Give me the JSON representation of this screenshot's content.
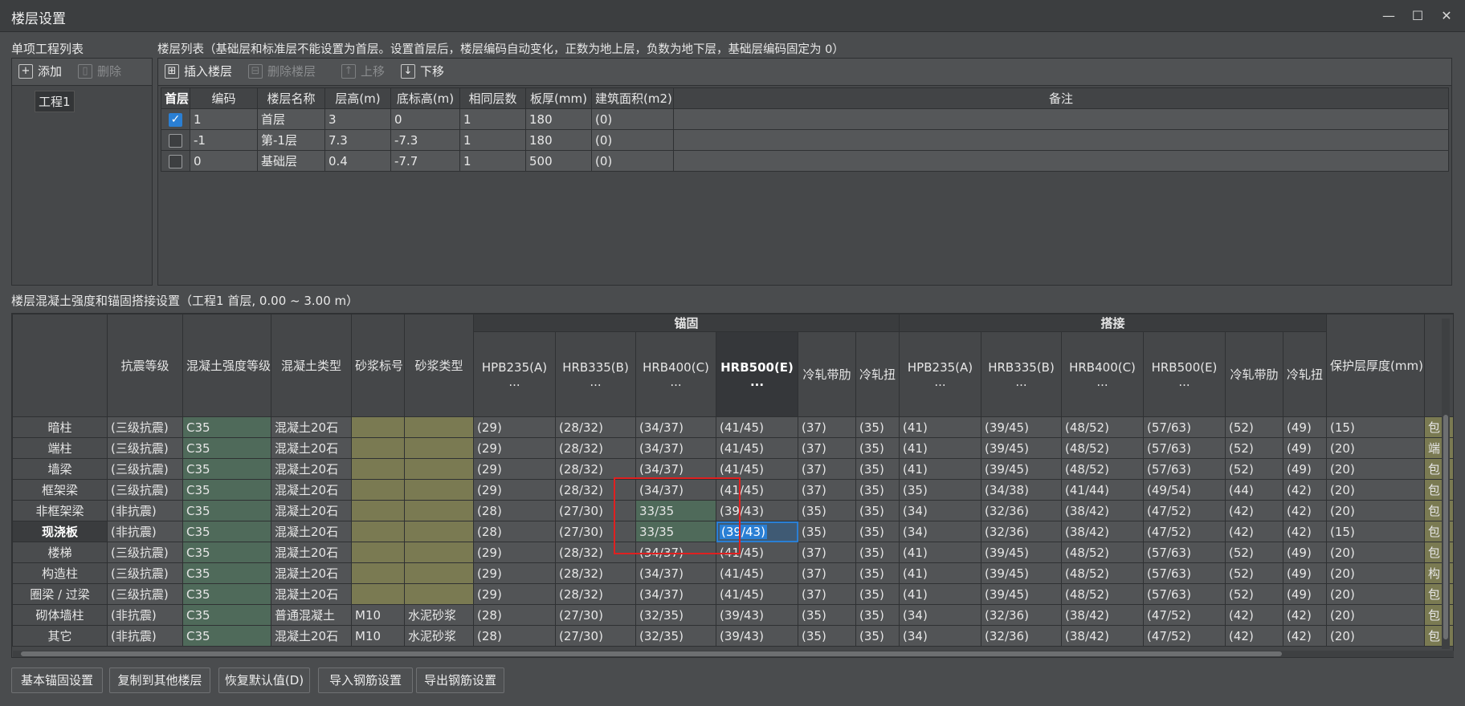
{
  "window": {
    "title": "楼层设置",
    "minimize": "—",
    "maximize": "☐",
    "close": "✕"
  },
  "project_panel": {
    "label": "单项工程列表",
    "add": "添加",
    "delete": "删除",
    "items": [
      "工程1"
    ]
  },
  "floor_panel": {
    "label": "楼层列表（基础层和标准层不能设置为首层。设置首层后，楼层编码自动变化，正数为地上层，负数为地下层，基础层编码固定为 0）",
    "insert": "插入楼层",
    "remove": "删除楼层",
    "up": "上移",
    "down": "下移",
    "headers": [
      "首层",
      "编码",
      "楼层名称",
      "层高(m)",
      "底标高(m)",
      "相同层数",
      "板厚(mm)",
      "建筑面积(m2)",
      "备注"
    ],
    "rows": [
      {
        "first": true,
        "cells": [
          "1",
          "首层",
          "3",
          "0",
          "1",
          "180",
          "(0)",
          ""
        ]
      },
      {
        "first": false,
        "cells": [
          "-1",
          "第-1层",
          "7.3",
          "-7.3",
          "1",
          "180",
          "(0)",
          ""
        ]
      },
      {
        "first": false,
        "cells": [
          "0",
          "基础层",
          "0.4",
          "-7.7",
          "1",
          "500",
          "(0)",
          ""
        ]
      }
    ]
  },
  "anchor_panel": {
    "label": "楼层混凝土强度和锚固搭接设置（工程1  首层, 0.00 ~ 3.00 m）",
    "group_anchor": "锚固",
    "group_lap": "搭接",
    "headers": [
      "抗震等级",
      "混凝土强度等级",
      "混凝土类型",
      "砂浆标号",
      "砂浆类型",
      "HPB235(A)\n...",
      "HRB335(B)\n...",
      "HRB400(C)\n...",
      "HRB500(E)\n...",
      "冷轧带肋",
      "冷轧扭",
      "HPB235(A)\n...",
      "HRB335(B)\n...",
      "HRB400(C)\n...",
      "HRB500(E)\n...",
      "冷轧带肋",
      "冷轧扭",
      "保护层厚度(mm)"
    ],
    "rows": [
      {
        "name": "暗柱",
        "cells": [
          "(三级抗震)",
          "C35",
          "混凝土20石",
          "",
          "",
          "(29)",
          "(28/32)",
          "(34/37)",
          "(41/45)",
          "(37)",
          "(35)",
          "(41)",
          "(39/45)",
          "(48/52)",
          "(57/63)",
          "(52)",
          "(49)",
          "(15)",
          "包"
        ]
      },
      {
        "name": "端柱",
        "cells": [
          "(三级抗震)",
          "C35",
          "混凝土20石",
          "",
          "",
          "(29)",
          "(28/32)",
          "(34/37)",
          "(41/45)",
          "(37)",
          "(35)",
          "(41)",
          "(39/45)",
          "(48/52)",
          "(57/63)",
          "(52)",
          "(49)",
          "(20)",
          "端"
        ]
      },
      {
        "name": "墙梁",
        "cells": [
          "(三级抗震)",
          "C35",
          "混凝土20石",
          "",
          "",
          "(29)",
          "(28/32)",
          "(34/37)",
          "(41/45)",
          "(37)",
          "(35)",
          "(41)",
          "(39/45)",
          "(48/52)",
          "(57/63)",
          "(52)",
          "(49)",
          "(20)",
          "包"
        ]
      },
      {
        "name": "框架梁",
        "cells": [
          "(三级抗震)",
          "C35",
          "混凝土20石",
          "",
          "",
          "(29)",
          "(28/32)",
          "(34/37)",
          "(41/45)",
          "(37)",
          "(35)",
          "(35)",
          "(34/38)",
          "(41/44)",
          "(49/54)",
          "(44)",
          "(42)",
          "(20)",
          "包"
        ]
      },
      {
        "name": "非框架梁",
        "cells": [
          "(非抗震)",
          "C35",
          "混凝土20石",
          "",
          "",
          "(28)",
          "(27/30)",
          "33/35",
          "(39/43)",
          "(35)",
          "(35)",
          "(34)",
          "(32/36)",
          "(38/42)",
          "(47/52)",
          "(42)",
          "(42)",
          "(20)",
          "包"
        ]
      },
      {
        "name": "现浇板",
        "cells": [
          "(非抗震)",
          "C35",
          "混凝土20石",
          "",
          "",
          "(28)",
          "(27/30)",
          "33/35",
          "(39/43)",
          "(35)",
          "(35)",
          "(34)",
          "(32/36)",
          "(38/42)",
          "(47/52)",
          "(42)",
          "(42)",
          "(15)",
          "包"
        ]
      },
      {
        "name": "楼梯",
        "cells": [
          "(三级抗震)",
          "C35",
          "混凝土20石",
          "",
          "",
          "(29)",
          "(28/32)",
          "(34/37)",
          "(41/45)",
          "(37)",
          "(35)",
          "(41)",
          "(39/45)",
          "(48/52)",
          "(57/63)",
          "(52)",
          "(49)",
          "(20)",
          "包"
        ]
      },
      {
        "name": "构造柱",
        "cells": [
          "(三级抗震)",
          "C35",
          "混凝土20石",
          "",
          "",
          "(29)",
          "(28/32)",
          "(34/37)",
          "(41/45)",
          "(37)",
          "(35)",
          "(41)",
          "(39/45)",
          "(48/52)",
          "(57/63)",
          "(52)",
          "(49)",
          "(20)",
          "构"
        ]
      },
      {
        "name": "圈梁 / 过梁",
        "cells": [
          "(三级抗震)",
          "C35",
          "混凝土20石",
          "",
          "",
          "(29)",
          "(28/32)",
          "(34/37)",
          "(41/45)",
          "(37)",
          "(35)",
          "(41)",
          "(39/45)",
          "(48/52)",
          "(57/63)",
          "(52)",
          "(49)",
          "(20)",
          "包"
        ]
      },
      {
        "name": "砌体墙柱",
        "cells": [
          "(非抗震)",
          "C35",
          "普通混凝土",
          "M10",
          "水泥砂浆",
          "(28)",
          "(27/30)",
          "(32/35)",
          "(39/43)",
          "(35)",
          "(35)",
          "(34)",
          "(32/36)",
          "(38/42)",
          "(47/52)",
          "(42)",
          "(42)",
          "(20)",
          "包"
        ]
      },
      {
        "name": "其它",
        "cells": [
          "(非抗震)",
          "C35",
          "混凝土20石",
          "M10",
          "水泥砂浆",
          "(28)",
          "(27/30)",
          "(32/35)",
          "(39/43)",
          "(35)",
          "(35)",
          "(34)",
          "(32/36)",
          "(38/42)",
          "(47/52)",
          "(42)",
          "(42)",
          "(20)",
          "包"
        ]
      }
    ]
  },
  "buttons": {
    "basic": "基本锚固设置",
    "copy": "复制到其他楼层",
    "restore": "恢复默认值(D)",
    "import": "导入钢筋设置",
    "export": "导出钢筋设置"
  },
  "colors": {
    "accent": "#2a7fd4",
    "highlight_box": "#e02020",
    "green_cell": "#4f6a5a",
    "olive_cell": "#7a7a52"
  }
}
